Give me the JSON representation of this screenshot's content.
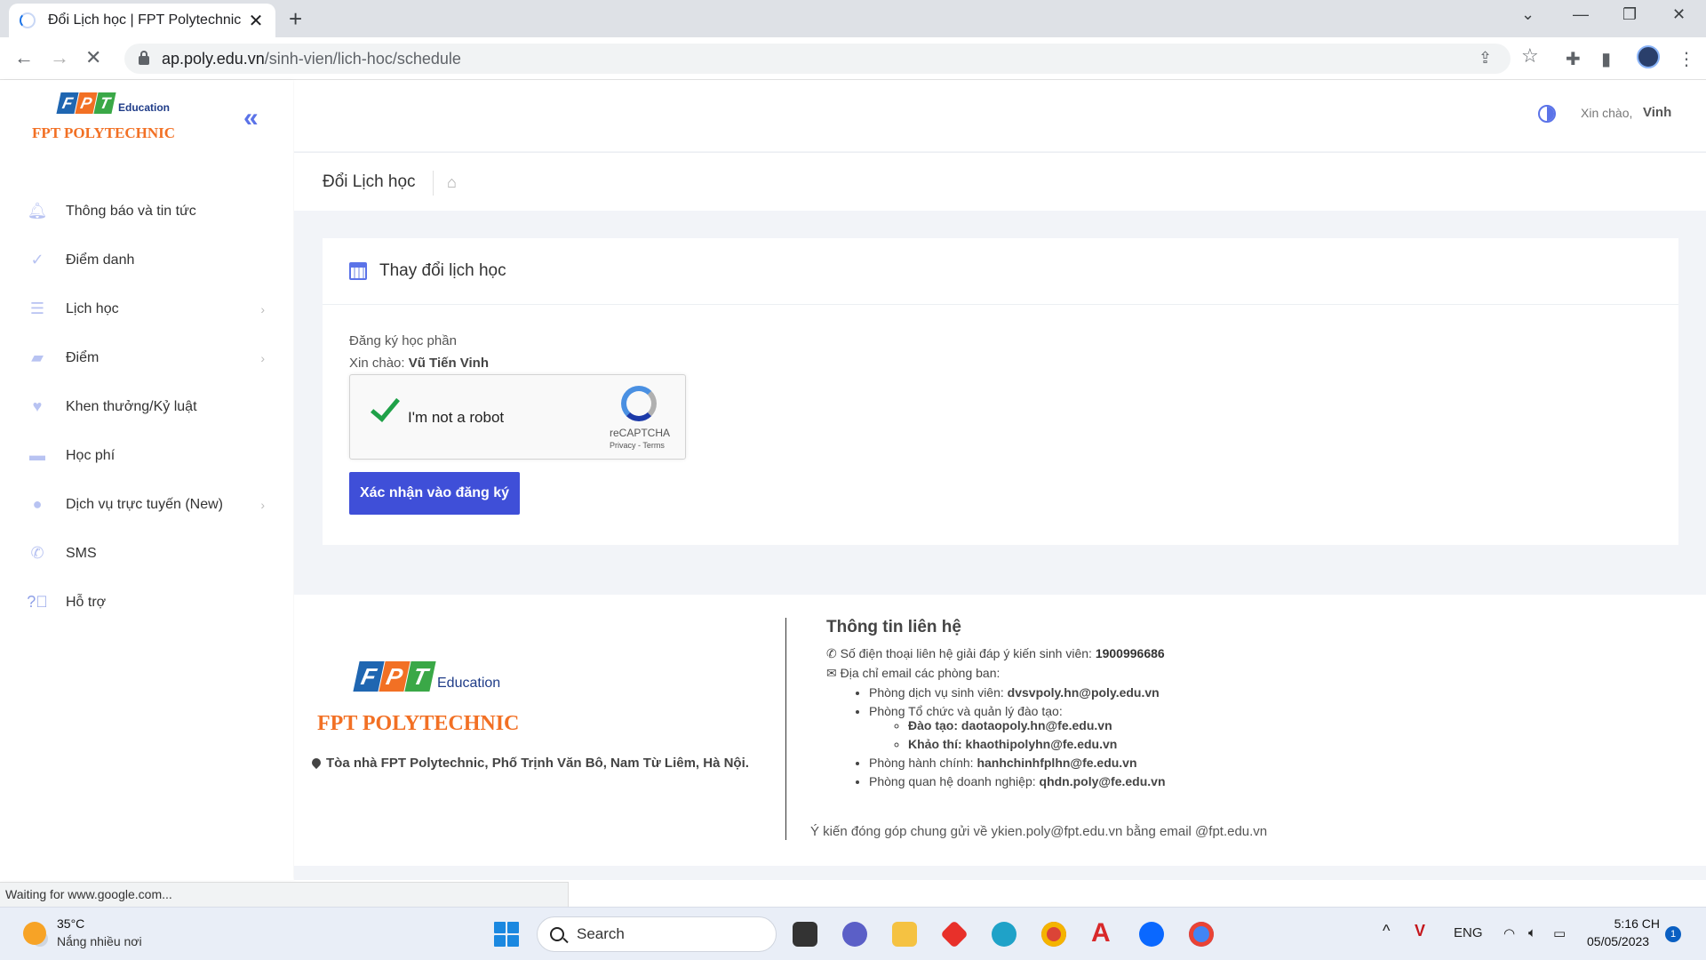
{
  "browser": {
    "tab_title": "Đổi Lịch học | FPT Polytechnic",
    "tab_close": "✕",
    "new_tab": "+",
    "url_domain": "ap.poly.edu.vn",
    "url_path": "/sinh-vien/lich-hoc/schedule",
    "status_text": "Waiting for www.google.com..."
  },
  "sidebar": {
    "logo_edu": "Education",
    "logo_poly": "FPT POLYTECHNIC",
    "items": [
      {
        "label": "Thông báo và tin tức",
        "icon": "bell-icon",
        "has_submenu": false
      },
      {
        "label": "Điểm danh",
        "icon": "check-icon",
        "has_submenu": false
      },
      {
        "label": "Lịch học",
        "icon": "list-icon",
        "has_submenu": true
      },
      {
        "label": "Điểm",
        "icon": "book-icon",
        "has_submenu": true
      },
      {
        "label": "Khen thưởng/Kỷ luật",
        "icon": "heart-icon",
        "has_submenu": false
      },
      {
        "label": "Học phí",
        "icon": "wallet-icon",
        "has_submenu": false
      },
      {
        "label": "Dịch vụ trực tuyến (New)",
        "icon": "globe-icon",
        "has_submenu": true
      },
      {
        "label": "SMS",
        "icon": "phone-icon",
        "has_submenu": false
      },
      {
        "label": "Hỗ trợ",
        "icon": "help-icon",
        "has_submenu": false
      }
    ]
  },
  "topbar": {
    "greeting": "Xin chào,",
    "user_short": "Vinh"
  },
  "page": {
    "title": "Đổi Lịch học"
  },
  "card": {
    "title": "Thay đổi lịch học",
    "register_label": "Đăng ký học phần",
    "hello_prefix": "Xin chào:",
    "hello_name": "Vũ Tiến Vinh",
    "captcha_label": "I'm not a robot",
    "captcha_brand": "reCAPTCHA",
    "captcha_links": "Privacy - Terms",
    "captcha_checked": true,
    "submit_label": "Xác nhận vào đăng ký"
  },
  "footer": {
    "logo_edu": "Education",
    "logo_poly": "FPT POLYTECHNIC",
    "address": "Tòa nhà FPT Polytechnic, Phố Trịnh Văn Bô, Nam Từ Liêm, Hà Nội.",
    "contact_title": "Thông tin liên hệ",
    "phone_label": "Số điện thoại liên hệ giải đáp ý kiến sinh viên:",
    "phone_value": "1900996686",
    "email_label": "Địa chỉ email các phòng ban:",
    "dept_student_label": "Phòng dịch vụ sinh viên:",
    "dept_student_email": "dvsvpoly.hn@poly.edu.vn",
    "dept_training_label": "Phòng Tổ chức và quản lý đào tạo:",
    "training_sub1": "Đào tạo: daotaopoly.hn@fe.edu.vn",
    "training_sub2": "Khảo thí: khaothipolyhn@fe.edu.vn",
    "dept_admin_label": "Phòng hành chính:",
    "dept_admin_email": "hanhchinhfplhn@fe.edu.vn",
    "dept_business_label": "Phòng quan hệ doanh nghiệp:",
    "dept_business_email": "qhdn.poly@fe.edu.vn",
    "feedback_note": "Ý kiến đóng góp chung gửi về ykien.poly@fpt.edu.vn bằng email @fpt.edu.vn"
  },
  "taskbar": {
    "temperature": "35°C",
    "weather": "Nắng nhiều nơi",
    "search_label": "Search",
    "language": "ENG",
    "time": "5:16 CH",
    "date": "05/05/2023",
    "notifications": "1"
  },
  "colors": {
    "accent": "#3f4fd8",
    "menu_icon": "#b8c3f2",
    "poly_orange": "#f27024",
    "captcha_check": "#1fa148"
  }
}
